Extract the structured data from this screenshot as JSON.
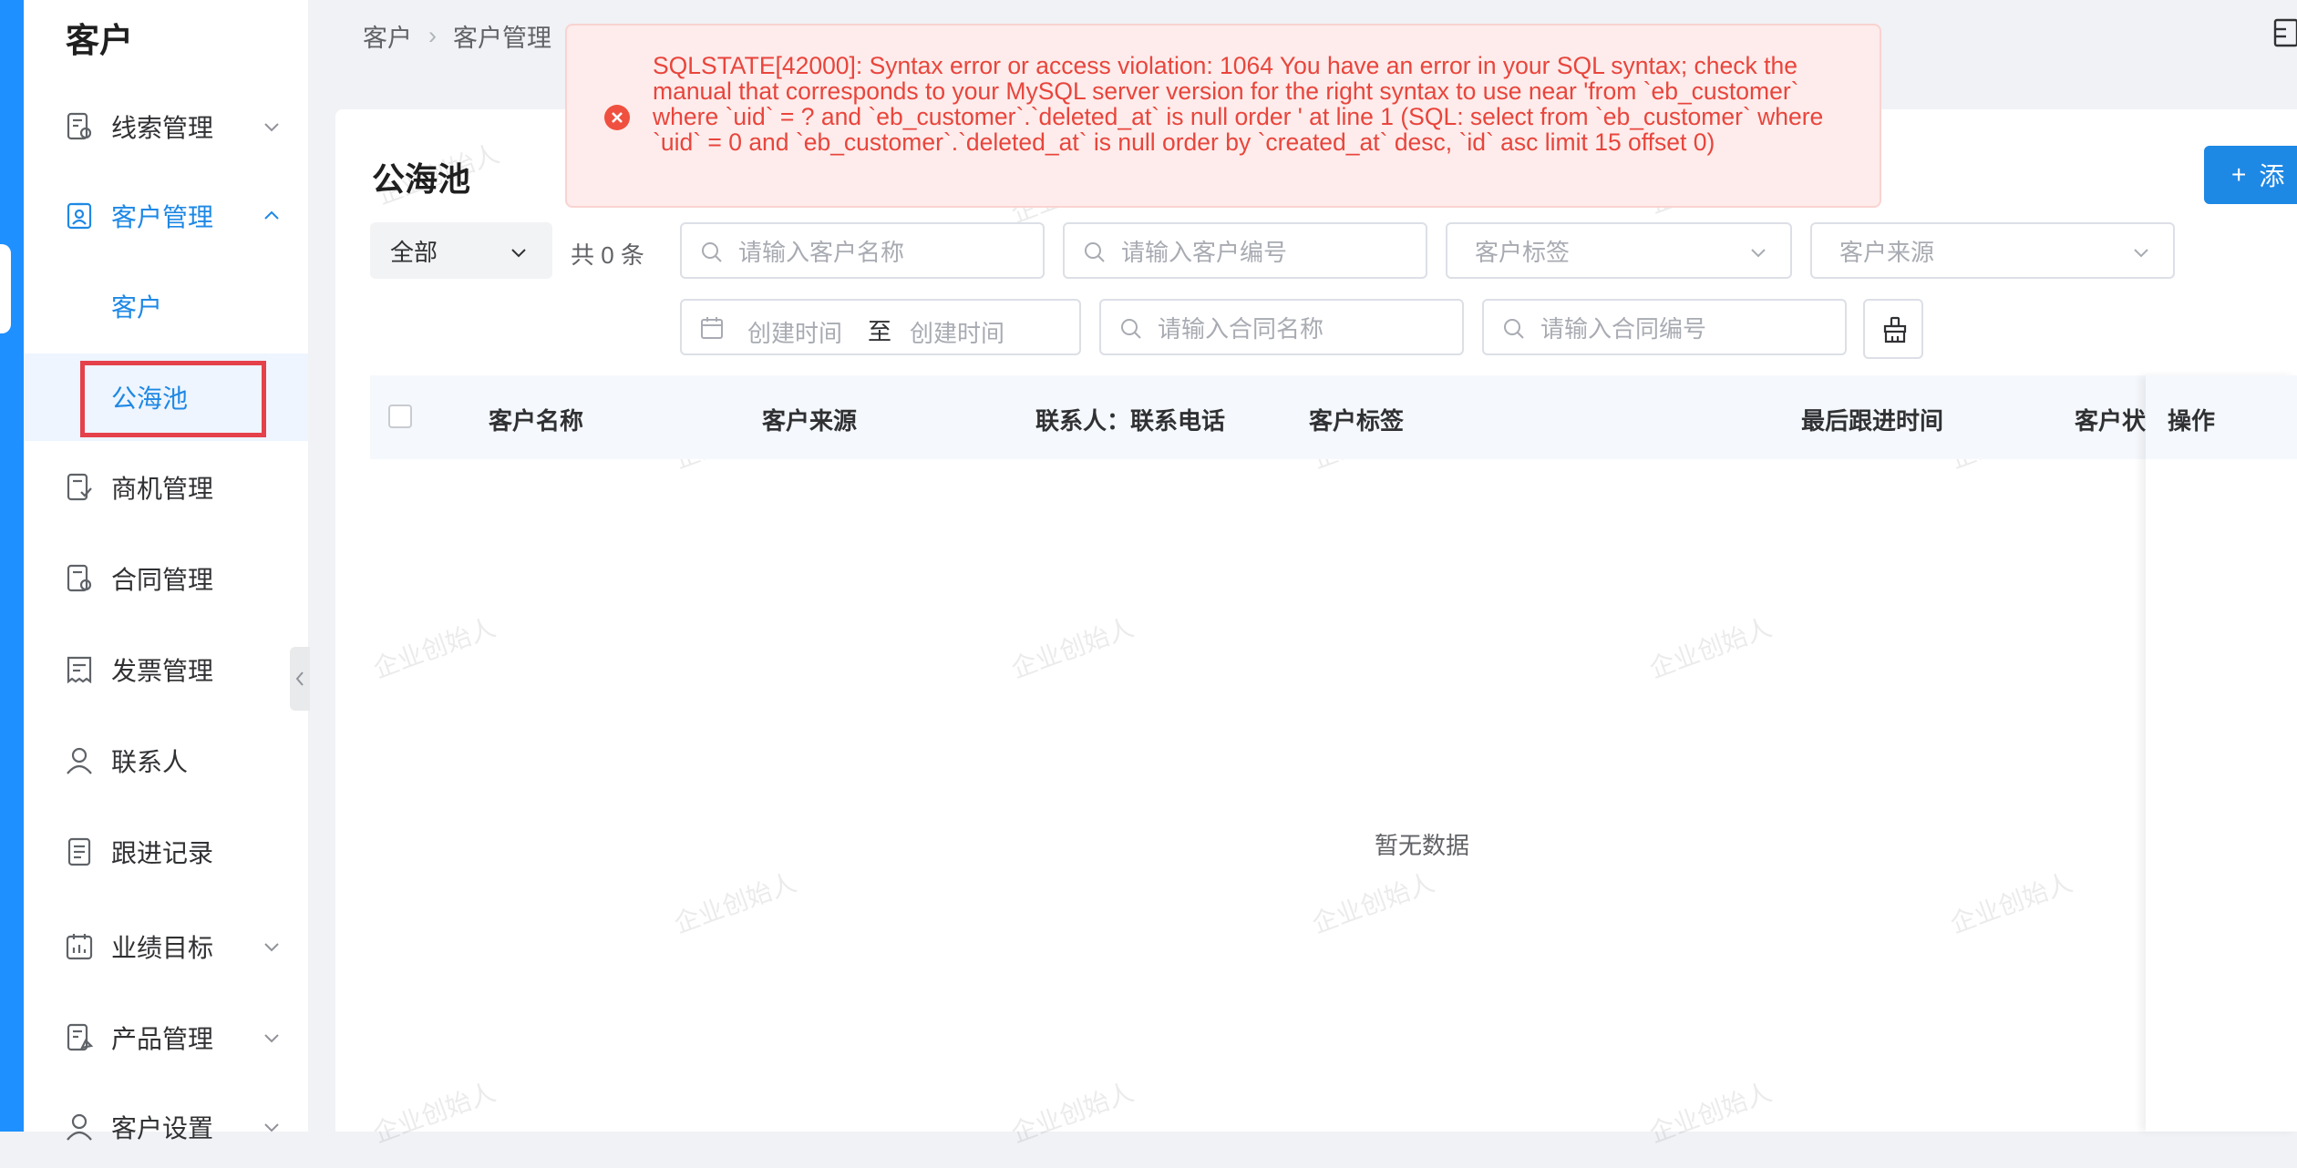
{
  "sidebar": {
    "title": "客户",
    "items": [
      {
        "label": "线索管理",
        "icon": "clue-doc-icon",
        "has_chevron": true
      },
      {
        "label": "客户管理",
        "icon": "customer-badge-icon",
        "has_chevron": true,
        "expanded": true
      },
      {
        "label": "商机管理",
        "icon": "opportunity-doc-icon"
      },
      {
        "label": "合同管理",
        "icon": "contract-doc-icon"
      },
      {
        "label": "发票管理",
        "icon": "invoice-icon"
      },
      {
        "label": "联系人",
        "icon": "person-icon"
      },
      {
        "label": "跟进记录",
        "icon": "list-doc-icon"
      },
      {
        "label": "业绩目标",
        "icon": "calendar-icon",
        "has_chevron": true
      },
      {
        "label": "产品管理",
        "icon": "product-doc-icon",
        "has_chevron": true
      },
      {
        "label": "客户设置",
        "icon": "settings-person-icon",
        "has_chevron": true
      }
    ],
    "sub_items": [
      {
        "label": "客户"
      },
      {
        "label": "公海池",
        "selected": true
      }
    ]
  },
  "breadcrumb": [
    "客户",
    "客户管理"
  ],
  "page": {
    "title": "公海池",
    "add_label": "添"
  },
  "filters": {
    "scope_select": "全部",
    "count_text": "共 0 条",
    "name_placeholder": "请输入客户名称",
    "code_placeholder": "请输入客户编号",
    "tag_placeholder": "客户标签",
    "source_placeholder": "客户来源",
    "date_start_placeholder": "创建时间",
    "date_to": "至",
    "date_end_placeholder": "创建时间",
    "contract_name_placeholder": "请输入合同名称",
    "contract_code_placeholder": "请输入合同编号"
  },
  "table": {
    "columns": [
      "客户名称",
      "客户来源",
      "联系人：联系电话",
      "客户标签",
      "最后跟进时间",
      "客户状"
    ],
    "ops_column": "操作",
    "empty_text": "暂无数据"
  },
  "watermark": "企业创始人",
  "error": {
    "message": "SQLSTATE[42000]: Syntax error or access violation: 1064 You have an error in your SQL syntax; check the manual that corresponds to your MySQL server version for the right syntax to use near 'from `eb_customer` where `uid` = ? and `eb_customer`.`deleted_at` is null order ' at line 1 (SQL: select from `eb_customer` where `uid` = 0 and `eb_customer`.`deleted_at` is null order by `created_at` desc, `id` asc limit 15 offset 0)",
    "color": "#e8453c"
  },
  "colors": {
    "accent": "#1e88e5",
    "highlight": "#e5414b"
  }
}
